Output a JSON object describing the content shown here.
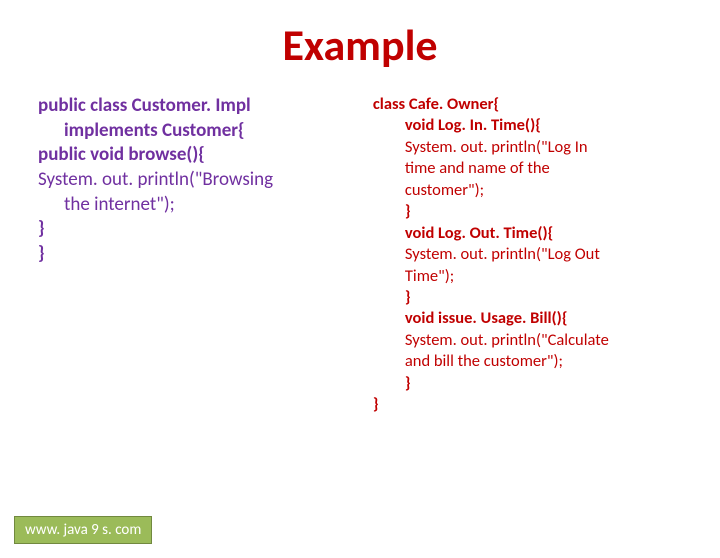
{
  "title": "Example",
  "left": {
    "l1a": "public class Customer. Impl",
    "l1b": "implements Customer{",
    "l2": "public void browse(){",
    "l3a": "System. out. println(\"Browsing",
    "l3b": "the internet\");",
    "l4": "}",
    "l5": "}"
  },
  "right": {
    "r1": "class Cafe. Owner{",
    "r2": "void Log. In. Time(){",
    "r3a": "System. out. println(\"Log  In",
    "r3b": "time and name of the",
    "r3c": "customer\");",
    "r4": "}",
    "r5": "void Log. Out. Time(){",
    "r6a": "System. out. println(\"Log Out",
    "r6b": "Time\");",
    "r7": "}",
    "r8": "void  issue. Usage. Bill(){",
    "r9a": "System. out. println(\"Calculate",
    "r9b": "and bill the customer\");",
    "r10": "}",
    "r11": "}"
  },
  "footer": "www. java 9 s. com"
}
